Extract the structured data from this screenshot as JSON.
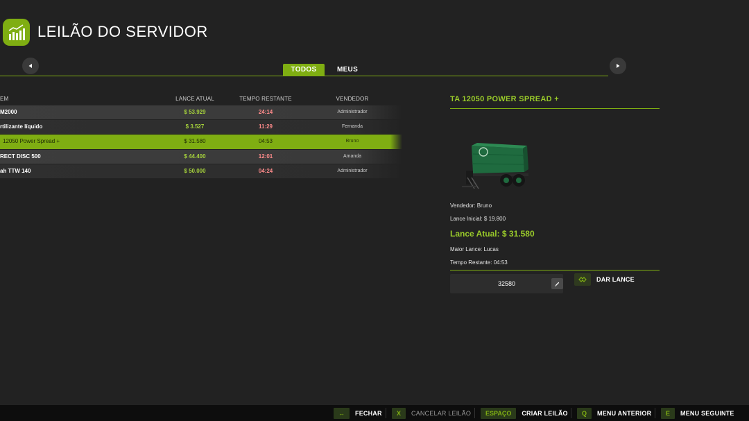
{
  "header": {
    "title": "LEILÃO DO SERVIDOR",
    "logo_icon": "bar-chart-icon"
  },
  "nav": {
    "prev_icon": "chevron-left-icon",
    "next_icon": "chevron-right-icon"
  },
  "tabs": [
    {
      "label": "TODOS",
      "active": true
    },
    {
      "label": "MEUS",
      "active": false
    }
  ],
  "table": {
    "columns": [
      "EM",
      "LANCE ATUAL",
      "TEMPO RESTANTE",
      "VENDEDOR"
    ],
    "rows": [
      {
        "item": "M2000",
        "bid": "$ 53.929",
        "time": "24:14",
        "seller": "Administrador",
        "selected": false
      },
      {
        "item": "rtilizante líquido",
        "bid": "$ 3.527",
        "time": "11:29",
        "seller": "Fernanda",
        "selected": false
      },
      {
        "item": "12050 Power Spread +",
        "bid": "$ 31.580",
        "time": "04:53",
        "seller": "Bruno",
        "selected": true
      },
      {
        "item": "RECT DISC 500",
        "bid": "$ 44.400",
        "time": "12:01",
        "seller": "Amanda",
        "selected": false
      },
      {
        "item": "ah TTW 140",
        "bid": "$ 50.000",
        "time": "04:24",
        "seller": "Administrador",
        "selected": false
      }
    ]
  },
  "detail": {
    "title": "TA 12050 POWER SPREAD +",
    "vendedor": "Vendedor: Bruno",
    "lance_inicial": "Lance Inicial: $ 19.800",
    "lance_atual": "Lance Atual: $ 31.580",
    "maior_lance": "Maior Lance: Lucas",
    "tempo_restante": "Tempo Restante: 04:53",
    "bid_input_value": "32580",
    "bid_button_label": "DAR LANCE",
    "image_icon": "manure-spreader-trailer-icon"
  },
  "footer": {
    "items": [
      {
        "key": "↔",
        "label": "FECHAR",
        "enabled": true
      },
      {
        "key": "X",
        "label": "CANCELAR LEILÃO",
        "enabled": false
      },
      {
        "key": "ESPAÇO",
        "label": "CRIAR LEILÃO",
        "enabled": true
      },
      {
        "key": "Q",
        "label": "MENU ANTERIOR",
        "enabled": true
      },
      {
        "key": "E",
        "label": "MENU SEGUINTE",
        "enabled": true
      }
    ]
  },
  "colors": {
    "accent": "#7fae12",
    "accent_text": "#9acb2a",
    "bid_text": "#a6d23c",
    "time_text": "#ff8b8b",
    "background": "#222222",
    "footer_bg": "#0d0d0d"
  }
}
